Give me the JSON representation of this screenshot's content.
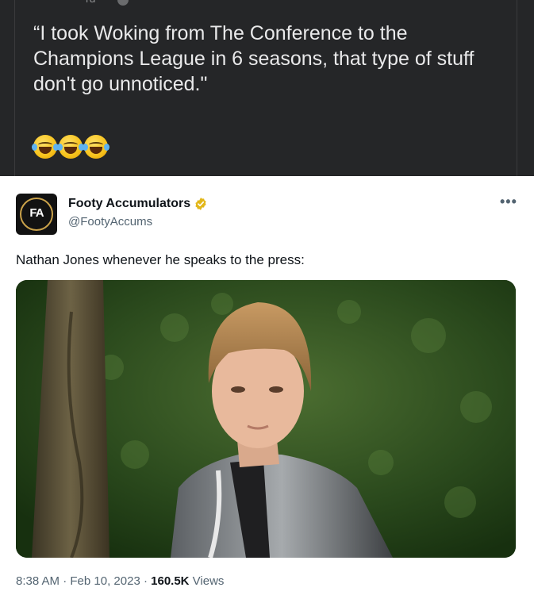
{
  "quoted_post": {
    "header_remnant": "rd",
    "quote_text": "“I took Woking from The Conference to the Champions League in 6 seasons, that type of stuff don't go unnoticed.\"",
    "emoji_icons": [
      "face-with-tears-of-joy",
      "face-with-tears-of-joy",
      "face-with-tears-of-joy"
    ]
  },
  "tweet": {
    "avatar_label": "FA",
    "display_name": "Footy Accumulators",
    "handle": "@FootyAccums",
    "more_label": "•••",
    "text": "Nathan Jones whenever he speaks to the press:",
    "time": "8:38 AM",
    "sep1": " · ",
    "date": "Feb 10, 2023",
    "sep2": " · ",
    "views_count": "160.5K",
    "views_label": " Views"
  },
  "colors": {
    "dark_bg": "#252628",
    "verified_gold": "#e2b719",
    "text_primary": "#0f1419",
    "text_secondary": "#536471"
  }
}
